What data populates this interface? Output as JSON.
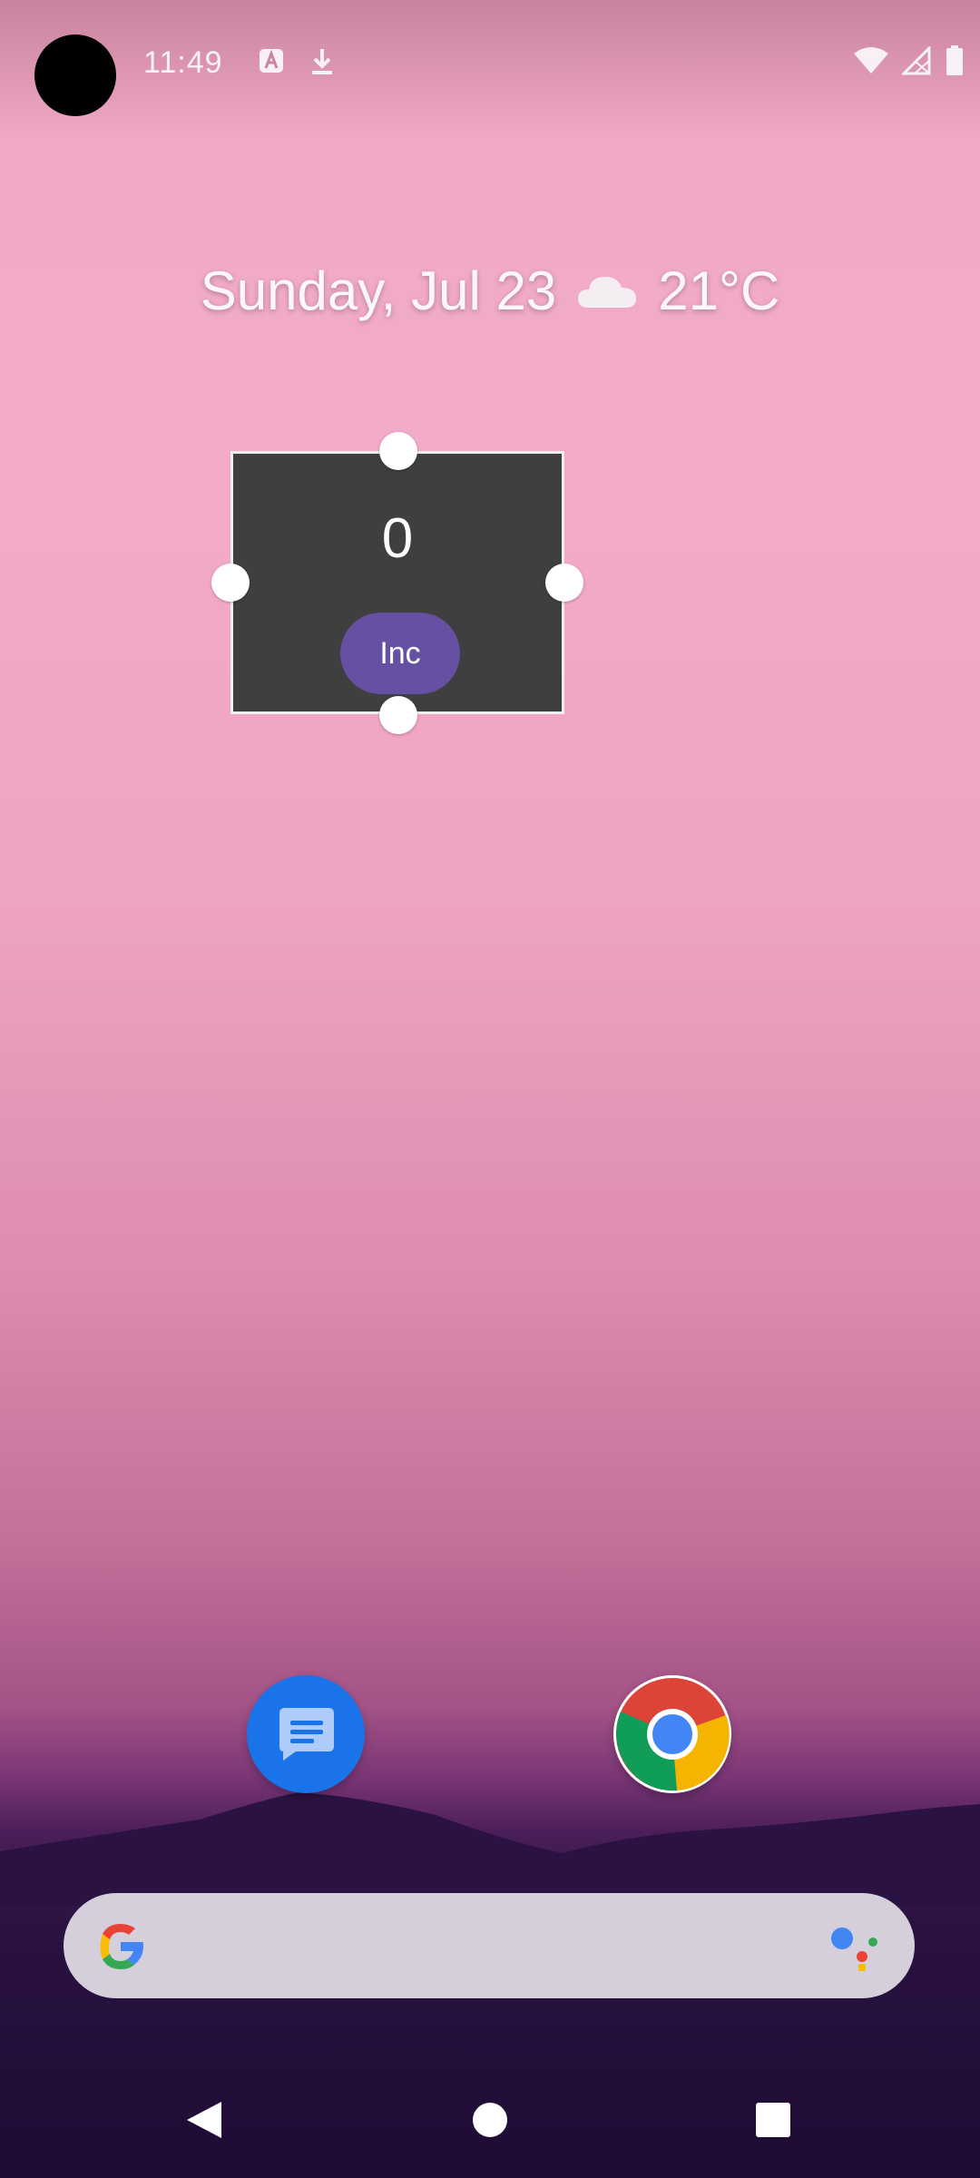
{
  "status_bar": {
    "time": "11:49",
    "icons": [
      "camera-cutout",
      "android-auto-icon",
      "download-icon",
      "wifi-icon",
      "no-signal-icon",
      "battery-icon"
    ]
  },
  "at_a_glance": {
    "date": "Sunday, Jul 23",
    "weather_icon": "cloud-icon",
    "temperature": "21°C"
  },
  "widget": {
    "count": "0",
    "button_label": "Inc",
    "colors": {
      "background": "#3f3f3f",
      "button": "#6650a4"
    }
  },
  "dock": {
    "apps": [
      {
        "name": "messages-icon"
      },
      {
        "name": "chrome-icon"
      }
    ]
  },
  "search": {
    "left_icon": "google-g-icon",
    "right_icon": "google-assistant-icon"
  },
  "nav_bar": {
    "buttons": [
      "back-button",
      "home-button",
      "recents-button"
    ]
  }
}
